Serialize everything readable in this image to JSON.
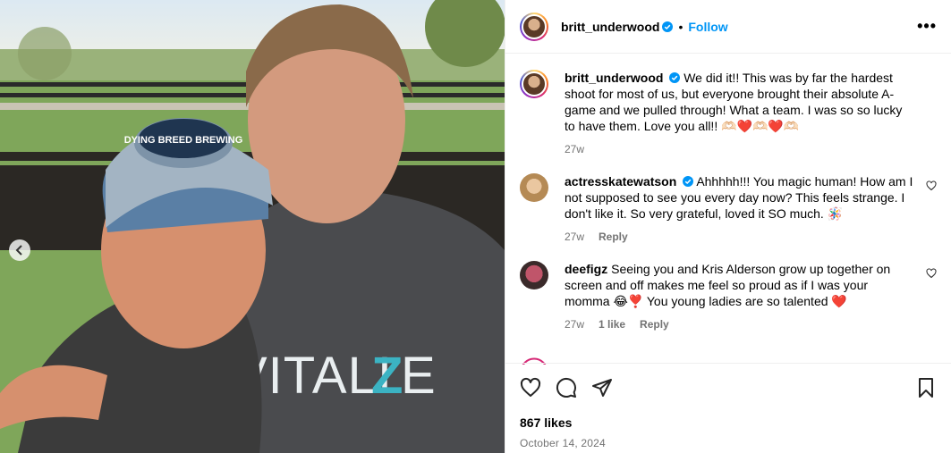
{
  "post": {
    "author": "britt_underwood",
    "follow_label": "Follow",
    "dot": "•",
    "more_label": "•••",
    "photo": {
      "shirt_text": "VITALIZE",
      "cap_text": "DYING BREED BREWING"
    }
  },
  "comments": [
    {
      "username": "britt_underwood",
      "verified": true,
      "text": "We did it!! This was by far the hardest shoot for most of us, but everyone brought their absolute A-game and we pulled through! What a team. I was so so lucky to have them. Love you all!! 🫶🏻❤️🫶🏻❤️🫶🏻",
      "time": "27w"
    },
    {
      "username": "actresskatewatson",
      "verified": true,
      "text": "Ahhhhh!!! You magic human! How am I not supposed to see you every day now? This feels strange. I don't like it. So very grateful, loved it SO much. 🪅",
      "time": "27w",
      "reply_label": "Reply"
    },
    {
      "username": "deefigz",
      "verified": false,
      "text": "Seeing you and Kris Alderson grow up together on screen and off makes me feel so proud as if I was your momma 😂❣️ You young ladies are so talented ❤️",
      "time": "27w",
      "likes_label": "1 like",
      "reply_label": "Reply"
    }
  ],
  "footer": {
    "likes": "867 likes",
    "date": "October 14, 2024"
  },
  "colors": {
    "accent": "#0095f6",
    "muted": "#737373",
    "heart": "#ed4956"
  }
}
